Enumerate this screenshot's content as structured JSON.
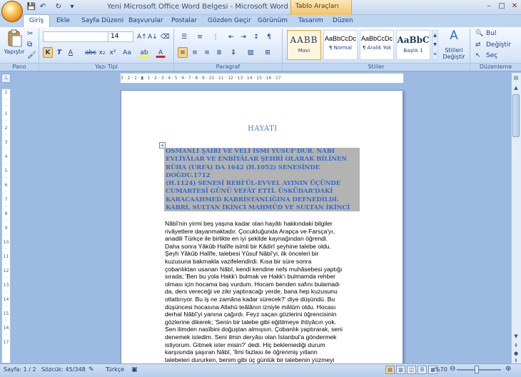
{
  "app": {
    "title": "Yeni Microsoft Office Word Belgesi - Microsoft Word",
    "tools_tab": "Tablo Araçları"
  },
  "qat": {
    "save": "💾",
    "undo": "↶",
    "redo": "↻",
    "customize": "▾"
  },
  "window": {
    "minimize": "–",
    "maximize": "□",
    "close": "✕"
  },
  "tabs": [
    "Giriş",
    "Ekle",
    "Sayfa Düzeni",
    "Başvurular",
    "Postalar",
    "Gözden Geçir",
    "Görünüm",
    "Tasarım",
    "Düzen"
  ],
  "ribbon": {
    "clipboard": {
      "paste": "Yapıştır",
      "label": "Pano"
    },
    "font": {
      "name": "",
      "size": "14",
      "bold": "K",
      "italic": "T",
      "underline": "A",
      "strike": "abc",
      "sub": "x₂",
      "sup": "x²",
      "case": "Aa",
      "highlight": "ab",
      "color": "A",
      "grow": "A↑",
      "shrink": "A↓",
      "label": "Yazı Tipi"
    },
    "paragraph": {
      "label": "Paragraf",
      "pilcrow": "¶"
    },
    "styles": {
      "items": [
        {
          "sample": "AABB",
          "name": "Mavi"
        },
        {
          "sample": "AaBbCcDc",
          "name": "¶ Normal"
        },
        {
          "sample": "AaBbCcDc",
          "name": "¶ Aralık Yok"
        },
        {
          "sample": "AaBbC",
          "name": "Başlık 1"
        }
      ],
      "change": "Stilleri Değiştir",
      "label": "Stiller"
    },
    "editing": {
      "find": "Bul",
      "replace": "Değiştir",
      "select": "Seç",
      "label": "Düzenleme"
    }
  },
  "ruler": {
    "h": "3 · 2 · 1 · ▮ · 1 · 2 · 3 · 4 · 5 · 6 · 7 · 8 · 9 · 10 · 11 · 12 · 13 · 14 · 15 · 16 · 17",
    "v": [
      "1",
      "·",
      "·",
      "1",
      "·",
      "2",
      "·",
      "3",
      "·",
      "4",
      "·",
      "5",
      "·",
      "6",
      "·",
      "7",
      "·",
      "8",
      "·",
      "9",
      "·",
      "10",
      "·",
      "11",
      "·",
      "12",
      "·",
      "13",
      "·",
      "14",
      "·",
      "15",
      "·",
      "16",
      "·",
      "17"
    ]
  },
  "document": {
    "title": "HAYATI",
    "heading": "OSMANLI ŞAİRİ VE VELİ İSMİ YÛSUF'DUR. NÂBÎ\nEVLİYÂLAR VE ENBİYÂLAR ŞEHRİ OLARAK BİLİNEN\nRÜHA (URFA) DA 1642 (H.1052) SENESİNDE DOĞDU.1712\n(H.1124) SENESİ REBÎ'ÜL-EVVEL AYININ ÜÇÜNDE\nCUMARTESİ GÜNÜ VEFÂT ETTİ. ÜSKÜDAR'DAKİ\nKARACAAHMED KABRİSTANLIĞINA DEFNEDİLDİ.\nKABRİ, SULTAN İKİNCİ MAHMÛD VE SULTAN İKİNCİ\nABDÜLHAMİD HÂN DEVİRLERİNDE TÂMİR EDİLDİ.",
    "body": "Nâbî'nin yirmi beş yaşına kadar olan hayâtı hakkındaki bilgiler\nrivâyetlere dayanmaktadır. Çocukluğunda Arapça ve Farsça'yı,\nanadili Türkçe ile birlikte en iyi şekilde kaynağından öğrendi.\nDaha sonra Yâkûb Halîfe isimli bir Kâdirî şeyhine talebe oldu.\nŞeyh Yâkûb Halîfe, talebesi Yûsuf Nâbî'yi, ilk önceleri bir\nkuzusuna bakmakla vazifelendirdi. Kısa bir süre sonra\nçobanlıktan usanan Nâbî, kendi kendine nefs muhâsebesi yaptığı\nsırada; 'Ben bu yola Hakk'ı bulmak ve Hakk'ı bulmamda rehber\nolması için hocama baş vurdum. Hocam benden safını bulamadı\nda, ders vereceği ve zikr yaptıracağı yerde, bana hep kuzusunu\notlattırıyor. Bu iş ne zamâna kadar sürecek?' diye düşündü. Bu\ndüşüncesi hocasına Allahü teâlânın izniyle mâlûm oldu. Hocası\nderhal Nâbî'yi yanına çağırdı. Feyz saçan gözlerini öğrencisinin\ngözlerine dikerek; 'Senin bir talebe gibi eğitilmeye ihtiyâcın yok.\nSen ilimden nasîbini doğuştan almışsın. Çobanlık yaptırarak, seni\ndenemek istedim. Seni ilmin deryâsı olan İstanbul'a göndermek\nistiyorum. Gitmek ister misin?' dedi. Hiç beklemediği durum\nkarşısında şaşıran Nâbî, 'İlmi fazlası ile öğrenmiş yıllann\ntalebeleri dururken, benim gibi üç günlük bir talebenin yüzmeyi"
  },
  "status": {
    "page": "Sayfa: 1 / 2",
    "words": "Sözcük: 45/348",
    "lang": "Türkçe",
    "zoom": "%70",
    "zoom_level": 0.45
  }
}
